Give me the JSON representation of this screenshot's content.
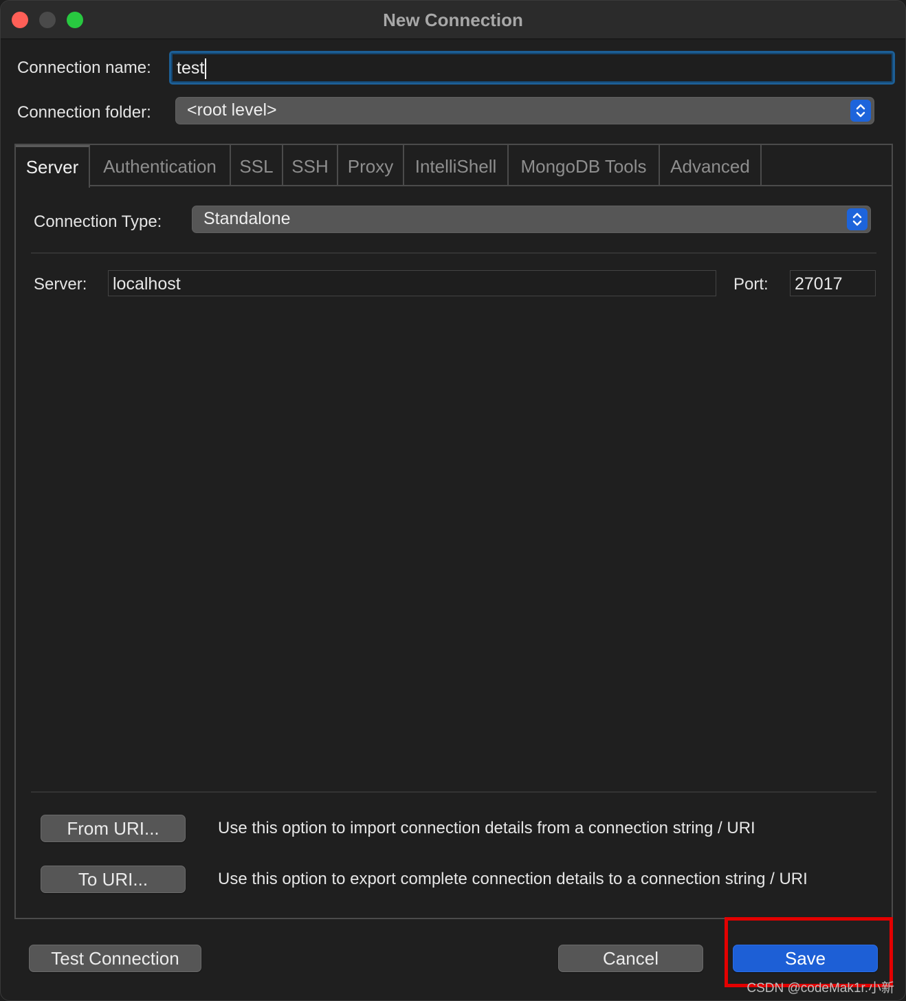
{
  "window": {
    "title": "New Connection"
  },
  "general": {
    "name_label": "Connection name:",
    "name_value": "test",
    "folder_label": "Connection folder:",
    "folder_value": "<root level>"
  },
  "tabs": [
    {
      "label": "Server",
      "active": true
    },
    {
      "label": "Authentication"
    },
    {
      "label": "SSL"
    },
    {
      "label": "SSH"
    },
    {
      "label": "Proxy"
    },
    {
      "label": "IntelliShell"
    },
    {
      "label": "MongoDB Tools"
    },
    {
      "label": "Advanced"
    }
  ],
  "server_tab": {
    "type_label": "Connection Type:",
    "type_value": "Standalone",
    "server_label": "Server:",
    "server_value": "localhost",
    "port_label": "Port:",
    "port_value": "27017"
  },
  "uri": {
    "from_label": "From URI...",
    "from_desc": "Use this option to import connection details from a connection string / URI",
    "to_label": "To URI...",
    "to_desc": "Use this option to export complete connection details to a connection string / URI"
  },
  "footer": {
    "test_label": "Test Connection",
    "cancel_label": "Cancel",
    "save_label": "Save"
  },
  "watermark": "CSDN @codeMak1r.小新",
  "colors": {
    "accent": "#1d5fd6",
    "highlight": "#e30000",
    "close": "#ff5f57",
    "maximize": "#28c840"
  }
}
